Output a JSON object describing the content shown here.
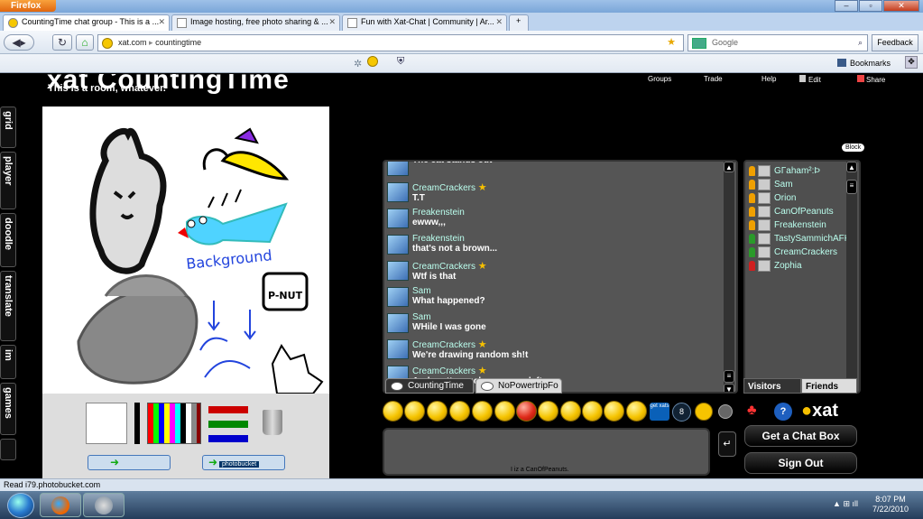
{
  "window": {
    "app_button": "Firefox",
    "controls": [
      "–",
      "▫",
      "✕"
    ]
  },
  "tabs": [
    {
      "title": "CountingTime chat group - This is a ...",
      "active": true
    },
    {
      "title": "Image hosting, free photo sharing & ...",
      "active": false
    },
    {
      "title": "Fun with Xat-Chat | Community | Ar...",
      "active": false
    }
  ],
  "navbar": {
    "url_domain": "xat.com",
    "url_path": "countingtime",
    "search_placeholder": "Google",
    "feedback_label": "Feedback"
  },
  "bookmarks_label": "Bookmarks",
  "page": {
    "room_title": "xat CountingTime",
    "room_description": "This is a room, whatever.",
    "top_links": [
      "Groups",
      "Trade",
      "Help",
      "Edit",
      "Share"
    ],
    "side_nav": [
      "grid",
      "player",
      "doodle",
      "translate",
      "im",
      "games"
    ]
  },
  "chat": {
    "messages": [
      {
        "name": "",
        "text": "The cat stands out",
        "star": false
      },
      {
        "name": "CreamCrackers",
        "text": "T.T",
        "star": true
      },
      {
        "name": "Freakenstein",
        "text": "ewww,,,",
        "star": false
      },
      {
        "name": "Freakenstein",
        "text": "that's not a brown...",
        "star": false
      },
      {
        "name": "CreamCrackers",
        "text": "Wtf is that",
        "star": true
      },
      {
        "name": "Sam",
        "text": "What happened?",
        "star": false
      },
      {
        "name": "Sam",
        "text": "WHile I was gone",
        "star": false
      },
      {
        "name": "CreamCrackers",
        "text": "We're drawing random sh!t",
        "star": true
      },
      {
        "name": "CreamCrackers",
        "text": "And pretty much everyone left",
        "star": true
      }
    ],
    "tabs": [
      "CountingTime",
      "NoPowertripFo"
    ],
    "input_text": "I iz a CanOfPeanuts."
  },
  "users": {
    "block_label": "Block",
    "list": [
      {
        "name": "GΓaham²:Þ",
        "color": "#f0a000"
      },
      {
        "name": "Sam",
        "color": "#f0a000"
      },
      {
        "name": "Orion",
        "color": "#f0a000"
      },
      {
        "name": "CanOfPeanuts",
        "color": "#f0a000"
      },
      {
        "name": "Freakenstein",
        "color": "#f0a000"
      },
      {
        "name": "TastySammichAFK",
        "color": "#2a9a2a"
      },
      {
        "name": "CreamCrackers",
        "color": "#2a9a2a"
      },
      {
        "name": "Zophia",
        "color": "#d02020"
      }
    ],
    "tabs": [
      "Visitors",
      "Friends"
    ]
  },
  "buttons": {
    "get_chat_box": "Get a Chat Box",
    "sign_out": "Sign Out",
    "get_xats": "get xats",
    "xat_logo": "xat",
    "photobucket": "photobucket"
  },
  "status_text": "Read i79.photobucket.com",
  "taskbar": {
    "time": "8:07 PM",
    "date": "7/22/2010"
  }
}
